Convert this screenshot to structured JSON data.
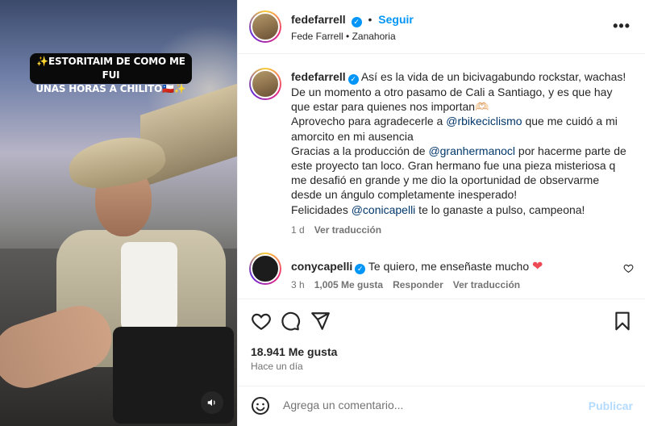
{
  "media": {
    "caption_line1": "✨ESTORITAIM DE COMO ME FUI",
    "caption_line2": "UNAS HORAS A CHILITO🇨🇱✨",
    "mute_icon": "speaker-icon"
  },
  "header": {
    "username": "fedefarrell",
    "separator": "•",
    "follow_label": "Seguir",
    "full_name": "Fede Farrell",
    "audio": "Zanahoria",
    "more_icon": "•••"
  },
  "post": {
    "username": "fedefarrell",
    "p1": "Así es la vida de un bicivagabundo rockstar, wachas! De un momento a otro pasamo de Cali a Santiago, y es que hay que estar para quienes nos importan🫶🏻",
    "p2_pre": "Aprovecho para agradecerle a ",
    "p2_mention": "@rbikeciclismo",
    "p2_post": " que me cuidó a mi amorcito en mi ausencia",
    "p3_pre": "Gracias a la producción de ",
    "p3_mention": "@granhermanocl",
    "p3_post": " por hacerme parte de este proyecto tan loco. Gran hermano fue una pieza misteriosa q me desafió en grande y me dio la oportunidad de observarme desde un ángulo completamente inesperado!",
    "p4_pre": "Felicidades ",
    "p4_mention": "@conicapelli",
    "p4_post": " te lo ganaste a pulso, campeona!",
    "age": "1 d",
    "translate": "Ver traducción"
  },
  "comment": {
    "username": "conycapelli",
    "text": "Te quiero, me enseñaste mucho",
    "emoji": "❤",
    "age": "3 h",
    "likes": "1,005 Me gusta",
    "reply": "Responder",
    "translate": "Ver traducción"
  },
  "footer": {
    "likes": "18.941 Me gusta",
    "time": "Hace un día",
    "placeholder": "Agrega un comentario...",
    "publish": "Publicar"
  },
  "colors": {
    "accent": "#0095f6",
    "mention": "#00376b",
    "heart": "#ed4956",
    "muted": "#737373"
  }
}
